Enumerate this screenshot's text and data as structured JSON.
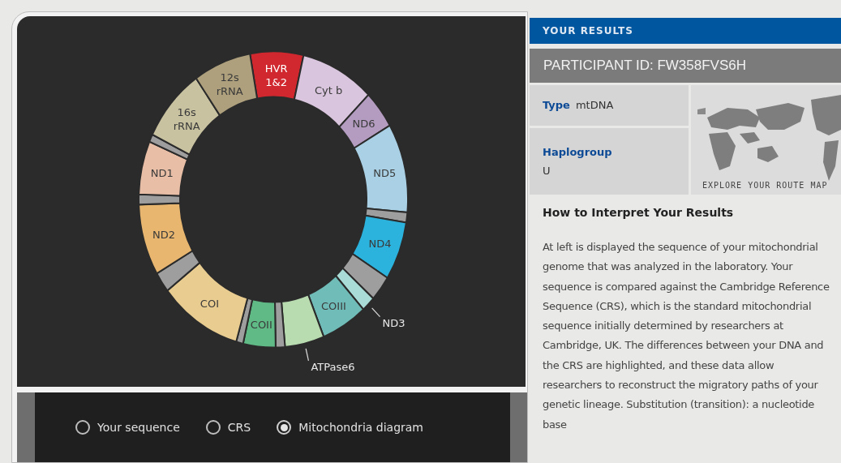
{
  "diagram": {
    "segments": [
      {
        "kind": "gene",
        "lines": [
          "HVR",
          "1&2"
        ],
        "color": "#d0282e"
      },
      {
        "kind": "gene",
        "lines": [
          "Cyt b"
        ],
        "color": "#d9c5dd"
      },
      {
        "kind": "gene",
        "lines": [
          "ND6"
        ],
        "color": "#b39cc0"
      },
      {
        "kind": "gene",
        "lines": [
          "ND5"
        ],
        "color": "#a9d0e4"
      },
      {
        "kind": "spacer",
        "color": "#9e9e9e"
      },
      {
        "kind": "gene",
        "lines": [
          "ND4"
        ],
        "color": "#2bb3dd"
      },
      {
        "kind": "spacer",
        "color": "#9e9e9e"
      },
      {
        "kind": "callout",
        "lines": [
          "ND3"
        ],
        "color": "#a9dcd6"
      },
      {
        "kind": "gene",
        "lines": [
          "COIII"
        ],
        "color": "#70bcb8"
      },
      {
        "kind": "callout",
        "lines": [
          "ATPase6"
        ],
        "color": "#b8dbb0"
      },
      {
        "kind": "spacer",
        "color": "#9e9e9e"
      },
      {
        "kind": "gene",
        "lines": [
          "COII"
        ],
        "color": "#5fba86"
      },
      {
        "kind": "spacer",
        "color": "#9e9e9e"
      },
      {
        "kind": "gene",
        "lines": [
          "COI"
        ],
        "color": "#e9cc8f"
      },
      {
        "kind": "spacer",
        "color": "#9e9e9e"
      },
      {
        "kind": "gene",
        "lines": [
          "ND2"
        ],
        "color": "#e8b66e"
      },
      {
        "kind": "spacer",
        "color": "#9e9e9e"
      },
      {
        "kind": "gene",
        "lines": [
          "ND1"
        ],
        "color": "#e8bfa6"
      },
      {
        "kind": "spacer",
        "color": "#9e9e9e"
      },
      {
        "kind": "gene",
        "lines": [
          "16s",
          "rRNA"
        ],
        "color": "#c8c2a0"
      },
      {
        "kind": "gene",
        "lines": [
          "12s",
          "rRNA"
        ],
        "color": "#aea07c"
      }
    ]
  },
  "view_options": [
    {
      "label": "Your sequence",
      "selected": false
    },
    {
      "label": "CRS",
      "selected": false
    },
    {
      "label": "Mitochondria diagram",
      "selected": true
    }
  ],
  "results": {
    "header": "YOUR RESULTS",
    "participant": "PARTICIPANT ID: FW358FVS6H",
    "type_label": "Type",
    "type_value": "mtDNA",
    "haplogroup_label": "Haplogroup",
    "haplogroup_value": "U",
    "map_link": "EXPLORE YOUR ROUTE MAP",
    "heading": "How to Interpret Your Results",
    "paragraph": "At left is displayed the sequence of your mitochondrial genome that was analyzed in the laboratory. Your sequence is compared against the Cambridge Reference Sequence (CRS), which is the standard mitochondrial sequence initially determined by researchers at Cambridge, UK. The differences between your DNA and the CRS are highlighted, and these data allow researchers to reconstruct the migratory paths of your genetic lineage. Substitution (transition): a nucleotide base"
  }
}
